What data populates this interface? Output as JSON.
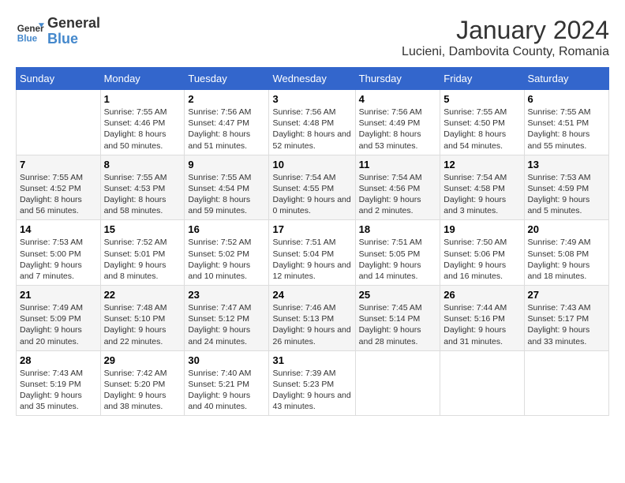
{
  "logo": {
    "brand1": "General",
    "brand2": "Blue"
  },
  "title": "January 2024",
  "subtitle": "Lucieni, Dambovita County, Romania",
  "weekdays": [
    "Sunday",
    "Monday",
    "Tuesday",
    "Wednesday",
    "Thursday",
    "Friday",
    "Saturday"
  ],
  "weeks": [
    [
      {
        "day": "",
        "sunrise": "",
        "sunset": "",
        "daylight": ""
      },
      {
        "day": "1",
        "sunrise": "Sunrise: 7:55 AM",
        "sunset": "Sunset: 4:46 PM",
        "daylight": "Daylight: 8 hours and 50 minutes."
      },
      {
        "day": "2",
        "sunrise": "Sunrise: 7:56 AM",
        "sunset": "Sunset: 4:47 PM",
        "daylight": "Daylight: 8 hours and 51 minutes."
      },
      {
        "day": "3",
        "sunrise": "Sunrise: 7:56 AM",
        "sunset": "Sunset: 4:48 PM",
        "daylight": "Daylight: 8 hours and 52 minutes."
      },
      {
        "day": "4",
        "sunrise": "Sunrise: 7:56 AM",
        "sunset": "Sunset: 4:49 PM",
        "daylight": "Daylight: 8 hours and 53 minutes."
      },
      {
        "day": "5",
        "sunrise": "Sunrise: 7:55 AM",
        "sunset": "Sunset: 4:50 PM",
        "daylight": "Daylight: 8 hours and 54 minutes."
      },
      {
        "day": "6",
        "sunrise": "Sunrise: 7:55 AM",
        "sunset": "Sunset: 4:51 PM",
        "daylight": "Daylight: 8 hours and 55 minutes."
      }
    ],
    [
      {
        "day": "7",
        "sunrise": "Sunrise: 7:55 AM",
        "sunset": "Sunset: 4:52 PM",
        "daylight": "Daylight: 8 hours and 56 minutes."
      },
      {
        "day": "8",
        "sunrise": "Sunrise: 7:55 AM",
        "sunset": "Sunset: 4:53 PM",
        "daylight": "Daylight: 8 hours and 58 minutes."
      },
      {
        "day": "9",
        "sunrise": "Sunrise: 7:55 AM",
        "sunset": "Sunset: 4:54 PM",
        "daylight": "Daylight: 8 hours and 59 minutes."
      },
      {
        "day": "10",
        "sunrise": "Sunrise: 7:54 AM",
        "sunset": "Sunset: 4:55 PM",
        "daylight": "Daylight: 9 hours and 0 minutes."
      },
      {
        "day": "11",
        "sunrise": "Sunrise: 7:54 AM",
        "sunset": "Sunset: 4:56 PM",
        "daylight": "Daylight: 9 hours and 2 minutes."
      },
      {
        "day": "12",
        "sunrise": "Sunrise: 7:54 AM",
        "sunset": "Sunset: 4:58 PM",
        "daylight": "Daylight: 9 hours and 3 minutes."
      },
      {
        "day": "13",
        "sunrise": "Sunrise: 7:53 AM",
        "sunset": "Sunset: 4:59 PM",
        "daylight": "Daylight: 9 hours and 5 minutes."
      }
    ],
    [
      {
        "day": "14",
        "sunrise": "Sunrise: 7:53 AM",
        "sunset": "Sunset: 5:00 PM",
        "daylight": "Daylight: 9 hours and 7 minutes."
      },
      {
        "day": "15",
        "sunrise": "Sunrise: 7:52 AM",
        "sunset": "Sunset: 5:01 PM",
        "daylight": "Daylight: 9 hours and 8 minutes."
      },
      {
        "day": "16",
        "sunrise": "Sunrise: 7:52 AM",
        "sunset": "Sunset: 5:02 PM",
        "daylight": "Daylight: 9 hours and 10 minutes."
      },
      {
        "day": "17",
        "sunrise": "Sunrise: 7:51 AM",
        "sunset": "Sunset: 5:04 PM",
        "daylight": "Daylight: 9 hours and 12 minutes."
      },
      {
        "day": "18",
        "sunrise": "Sunrise: 7:51 AM",
        "sunset": "Sunset: 5:05 PM",
        "daylight": "Daylight: 9 hours and 14 minutes."
      },
      {
        "day": "19",
        "sunrise": "Sunrise: 7:50 AM",
        "sunset": "Sunset: 5:06 PM",
        "daylight": "Daylight: 9 hours and 16 minutes."
      },
      {
        "day": "20",
        "sunrise": "Sunrise: 7:49 AM",
        "sunset": "Sunset: 5:08 PM",
        "daylight": "Daylight: 9 hours and 18 minutes."
      }
    ],
    [
      {
        "day": "21",
        "sunrise": "Sunrise: 7:49 AM",
        "sunset": "Sunset: 5:09 PM",
        "daylight": "Daylight: 9 hours and 20 minutes."
      },
      {
        "day": "22",
        "sunrise": "Sunrise: 7:48 AM",
        "sunset": "Sunset: 5:10 PM",
        "daylight": "Daylight: 9 hours and 22 minutes."
      },
      {
        "day": "23",
        "sunrise": "Sunrise: 7:47 AM",
        "sunset": "Sunset: 5:12 PM",
        "daylight": "Daylight: 9 hours and 24 minutes."
      },
      {
        "day": "24",
        "sunrise": "Sunrise: 7:46 AM",
        "sunset": "Sunset: 5:13 PM",
        "daylight": "Daylight: 9 hours and 26 minutes."
      },
      {
        "day": "25",
        "sunrise": "Sunrise: 7:45 AM",
        "sunset": "Sunset: 5:14 PM",
        "daylight": "Daylight: 9 hours and 28 minutes."
      },
      {
        "day": "26",
        "sunrise": "Sunrise: 7:44 AM",
        "sunset": "Sunset: 5:16 PM",
        "daylight": "Daylight: 9 hours and 31 minutes."
      },
      {
        "day": "27",
        "sunrise": "Sunrise: 7:43 AM",
        "sunset": "Sunset: 5:17 PM",
        "daylight": "Daylight: 9 hours and 33 minutes."
      }
    ],
    [
      {
        "day": "28",
        "sunrise": "Sunrise: 7:43 AM",
        "sunset": "Sunset: 5:19 PM",
        "daylight": "Daylight: 9 hours and 35 minutes."
      },
      {
        "day": "29",
        "sunrise": "Sunrise: 7:42 AM",
        "sunset": "Sunset: 5:20 PM",
        "daylight": "Daylight: 9 hours and 38 minutes."
      },
      {
        "day": "30",
        "sunrise": "Sunrise: 7:40 AM",
        "sunset": "Sunset: 5:21 PM",
        "daylight": "Daylight: 9 hours and 40 minutes."
      },
      {
        "day": "31",
        "sunrise": "Sunrise: 7:39 AM",
        "sunset": "Sunset: 5:23 PM",
        "daylight": "Daylight: 9 hours and 43 minutes."
      },
      {
        "day": "",
        "sunrise": "",
        "sunset": "",
        "daylight": ""
      },
      {
        "day": "",
        "sunrise": "",
        "sunset": "",
        "daylight": ""
      },
      {
        "day": "",
        "sunrise": "",
        "sunset": "",
        "daylight": ""
      }
    ]
  ]
}
